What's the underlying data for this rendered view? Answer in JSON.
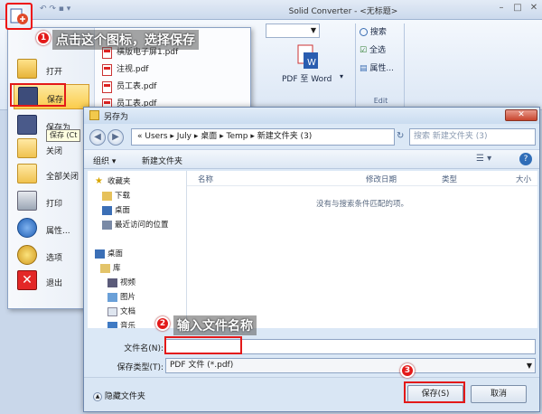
{
  "app": {
    "title": "Solid Converter - <无标题>"
  },
  "ribbon": {
    "pdf_to_word": "PDF 至 Word",
    "search": "搜索",
    "select_all": "全选",
    "properties": "属性...",
    "edit_group": "Edit"
  },
  "file_menu": {
    "items": [
      {
        "label": "打开"
      },
      {
        "label": "保存"
      },
      {
        "label": "保存为"
      },
      {
        "label": "关闭"
      },
      {
        "label": "全部关闭"
      },
      {
        "label": "打印"
      },
      {
        "label": "属性..."
      },
      {
        "label": "选项"
      },
      {
        "label": "退出"
      }
    ],
    "tooltip": "保存 (Ct",
    "recent_files": [
      "横版电子屏1.pdf",
      "注视.pdf",
      "员工表.pdf",
      "员工表.pdf"
    ]
  },
  "dialog": {
    "title": "另存为",
    "close": "✕",
    "address": "« Users ▸ July ▸ 桌面 ▸ Temp ▸ 新建文件夹 (3)",
    "search_placeholder": "搜索 新建文件夹 (3)",
    "toolbar": {
      "organize": "组织 ▾",
      "new_folder": "新建文件夹"
    },
    "nav_tree": [
      "收藏夹",
      "下载",
      "桌面",
      "最近访问的位置",
      "桌面",
      "库",
      "视频",
      "图片",
      "文档",
      "音乐"
    ],
    "columns": {
      "name": "名称",
      "modified": "修改日期",
      "type": "类型",
      "size": "大小"
    },
    "empty_message": "没有与搜索条件匹配的项。",
    "filename_label": "文件名(N):",
    "filename_value": "",
    "filetype_label": "保存类型(T):",
    "filetype_value": "PDF 文件 (*.pdf)",
    "hide_folders": "隐藏文件夹",
    "save_button": "保存(S)",
    "cancel_button": "取消"
  },
  "annotations": {
    "step1": "点击这个图标，选择保存",
    "step2": "输入文件名称",
    "badge1": "1",
    "badge2": "2",
    "badge3": "3"
  },
  "colors": {
    "annotation_red": "#e31919",
    "menu_highlight": "#fbcc4b"
  }
}
